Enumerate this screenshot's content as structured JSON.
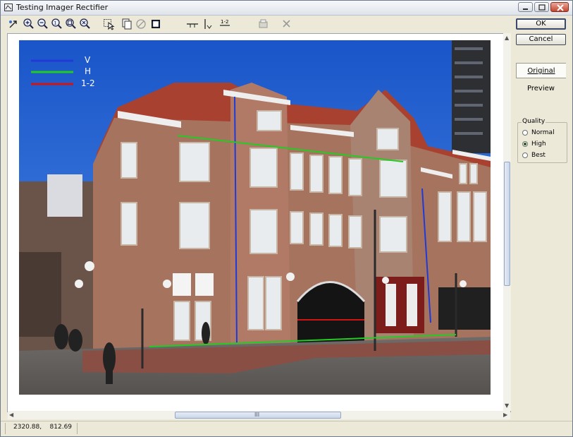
{
  "window": {
    "title": "Testing Imager Rectifier"
  },
  "toolbar": {
    "tools": [
      "select-arrow-icon",
      "zoom-in-icon",
      "zoom-out-icon",
      "zoom-actual-icon",
      "zoom-fit-icon",
      "zoom-window-icon",
      "pointer-select-icon",
      "copy-icon",
      "clear-icon",
      "crop-icon",
      "horizontal-line-icon",
      "vertical-line-icon",
      "point-line-icon",
      "export-icon",
      "delete-icon"
    ]
  },
  "overlay_legend": [
    {
      "label": "V",
      "color": "#1f3ad6"
    },
    {
      "label": "H",
      "color": "#22cc22"
    },
    {
      "label": "1-2",
      "color": "#d01414"
    }
  ],
  "buttons": {
    "ok": "OK",
    "cancel": "Cancel"
  },
  "tabs": {
    "original": "Original",
    "preview": "Preview"
  },
  "quality": {
    "title": "Quality",
    "options": [
      "Normal",
      "High",
      "Best"
    ],
    "selected": "High"
  },
  "status": {
    "x": "2320.88,",
    "y": "812.69"
  },
  "scrollbar": {
    "grip": "III"
  }
}
